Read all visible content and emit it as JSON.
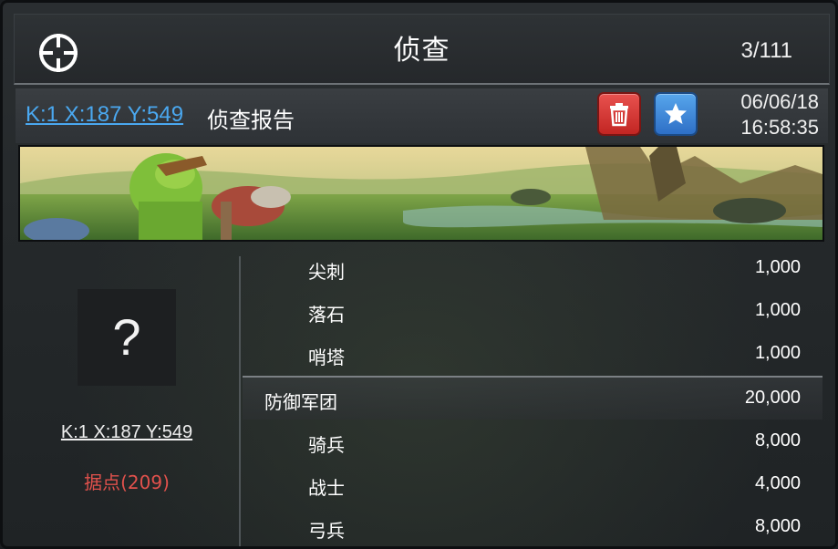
{
  "title": "侦查",
  "page_count": "3/111",
  "report": {
    "coord_link": "K:1 X:187 Y:549",
    "label": "侦查报告",
    "date": "06/06/18",
    "time": "16:58:35"
  },
  "target": {
    "placeholder": "?",
    "coords": "K:1 X:187 Y:549",
    "type": "据点(209)"
  },
  "items": [
    {
      "name": "尖刺",
      "value": "1,000"
    },
    {
      "name": "落石",
      "value": "1,000"
    },
    {
      "name": "哨塔",
      "value": "1,000"
    },
    {
      "name": "防御军团",
      "value": "20,000"
    },
    {
      "name": "骑兵",
      "value": "8,000"
    },
    {
      "name": "战士",
      "value": "4,000"
    },
    {
      "name": "弓兵",
      "value": "8,000"
    }
  ],
  "colors": {
    "link": "#4aa8f0",
    "stronghold": "#e0514c",
    "delete_button": "#d0302d",
    "favorite_button": "#3e86d8"
  },
  "icons": {
    "target": "crosshair-icon",
    "delete": "trash-icon",
    "favorite": "star-icon"
  }
}
